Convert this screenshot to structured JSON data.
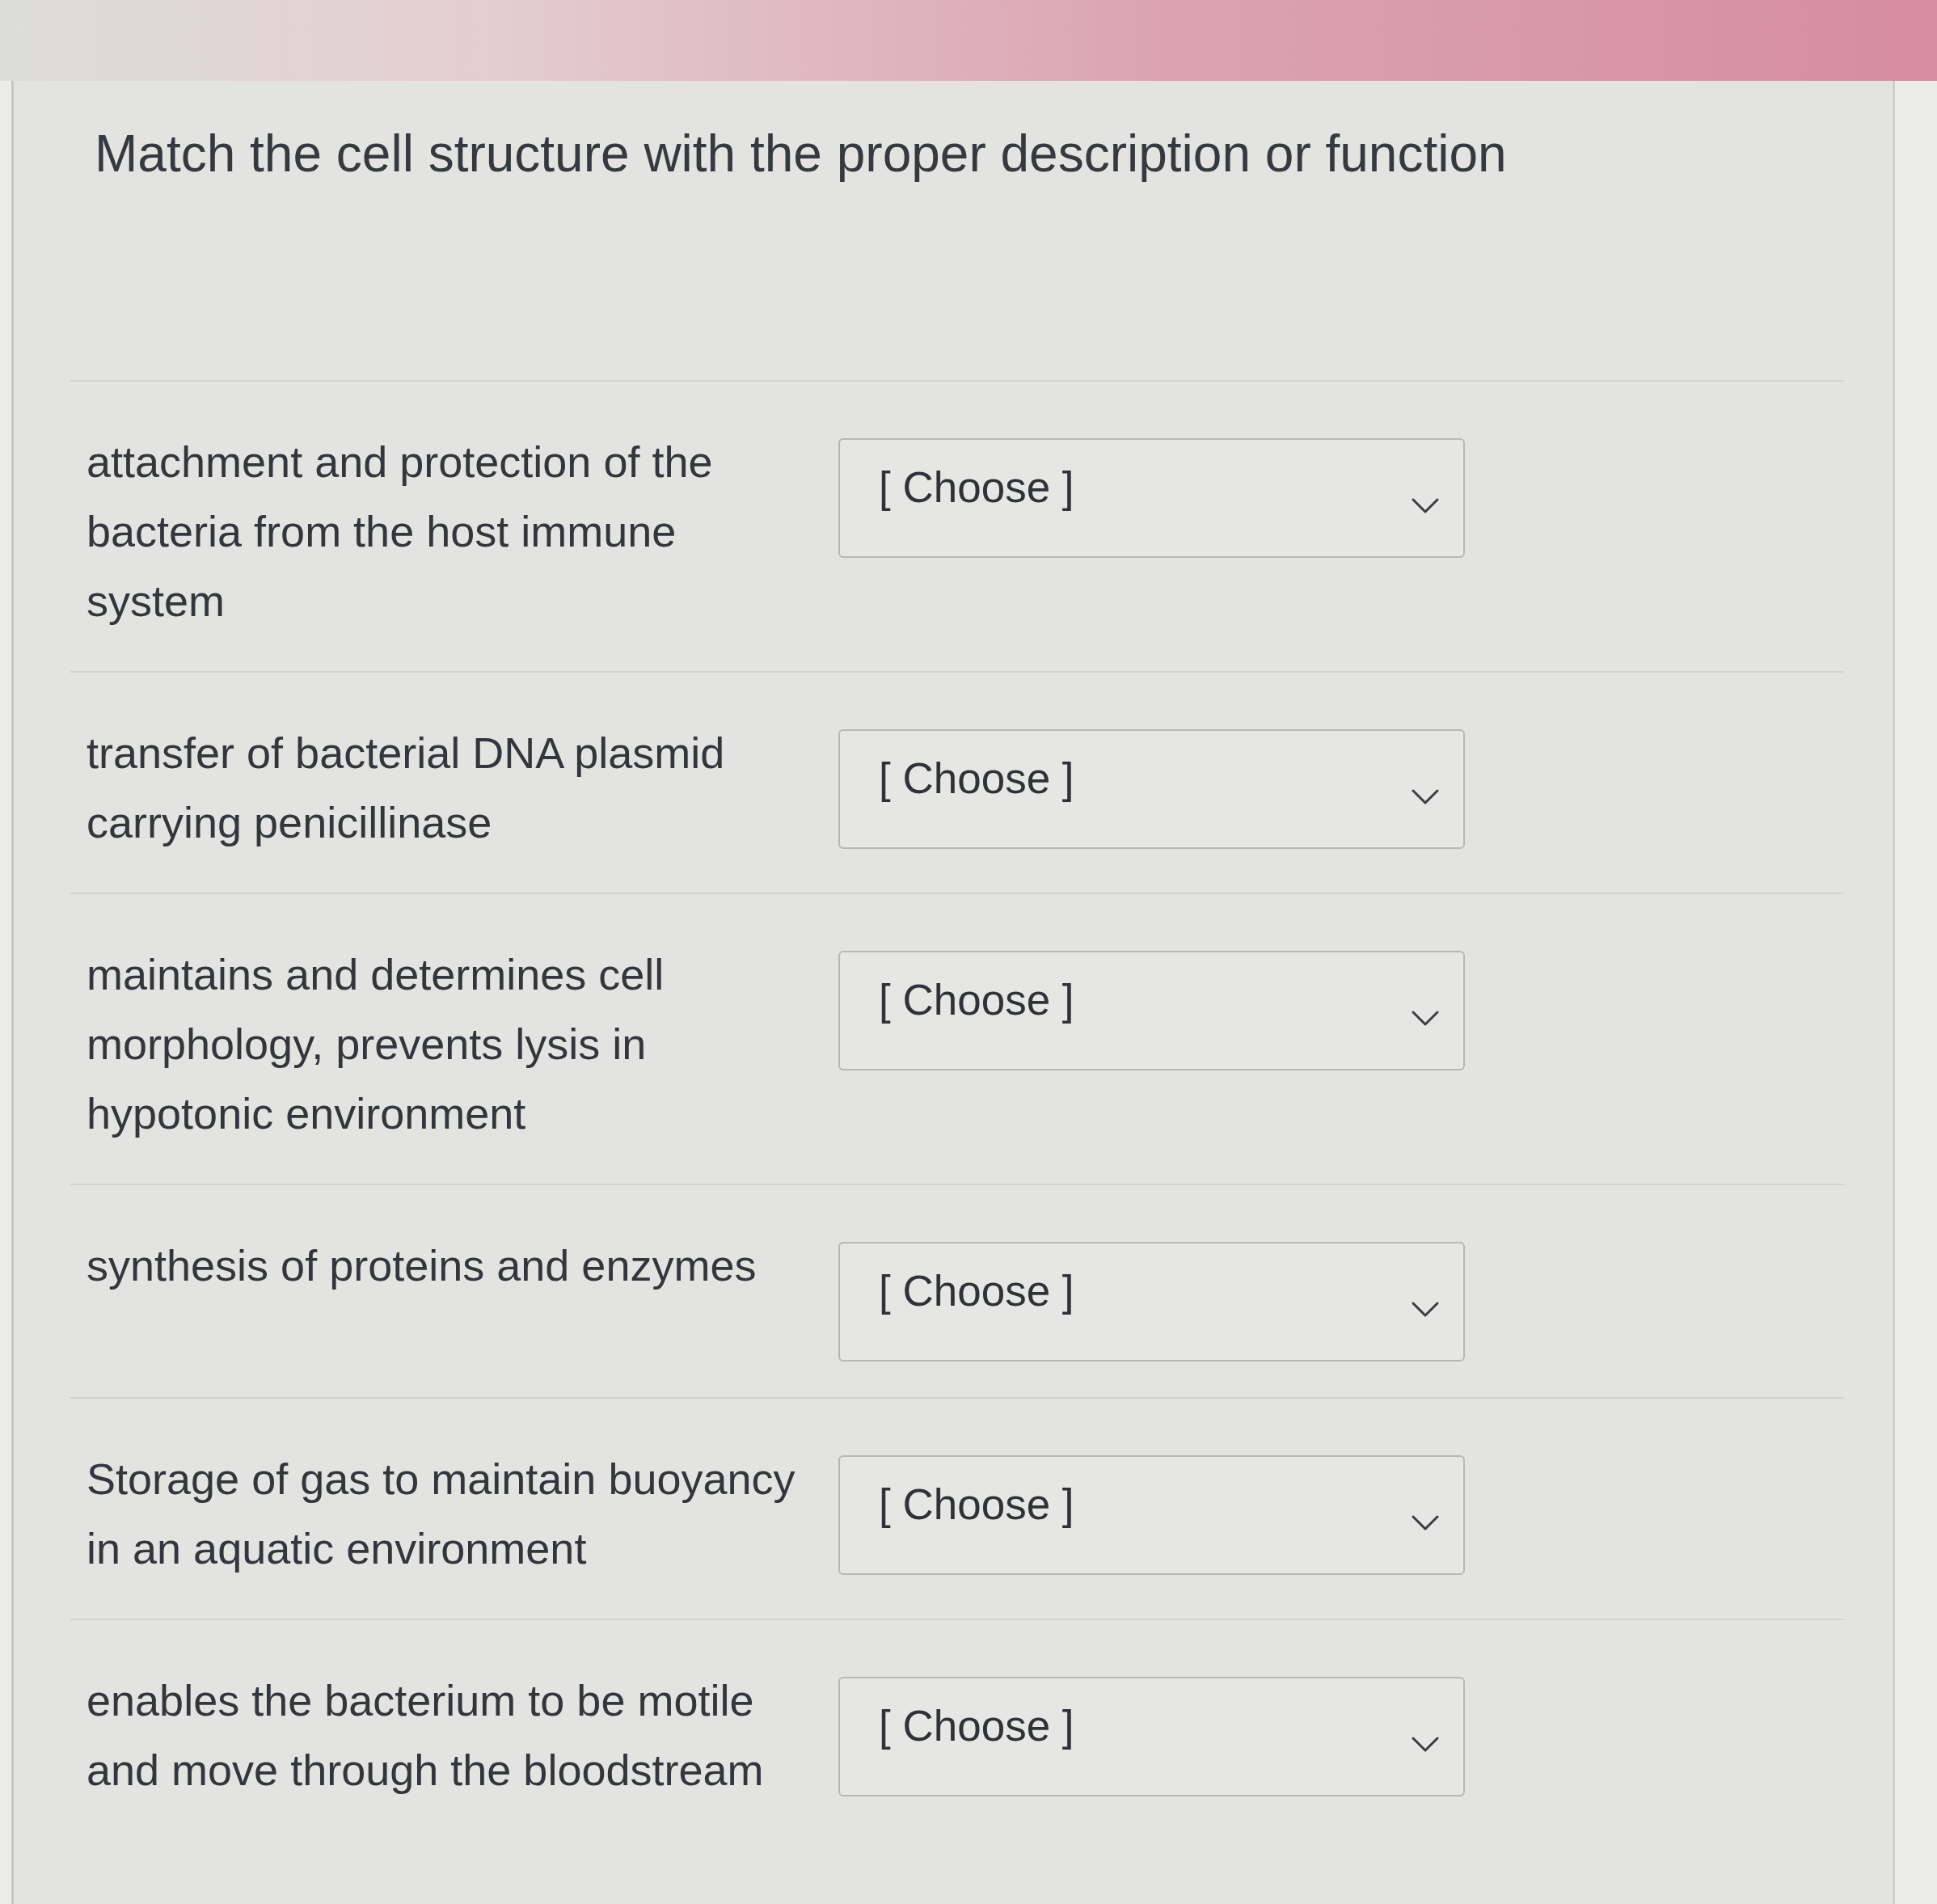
{
  "title": "Match the cell structure with the proper description or function",
  "items": [
    {
      "description": "attachment and protection of the bacteria from the host immune system",
      "dropdown": {
        "value": "[ Choose ]"
      }
    },
    {
      "description": "transfer of bacterial DNA plasmid carrying penicillinase",
      "dropdown": {
        "value": "[ Choose ]"
      }
    },
    {
      "description": "maintains and determines cell morphology, prevents lysis in hypotonic environment",
      "dropdown": {
        "value": "[ Choose ]"
      }
    },
    {
      "description": "synthesis of proteins and enzymes",
      "dropdown": {
        "value": "[ Choose ]"
      }
    },
    {
      "description": "Storage of gas to maintain buoyancy in an aquatic environment",
      "dropdown": {
        "value": "[ Choose ]"
      }
    },
    {
      "description": "enables the bacterium to be motile and move through the bloodstream",
      "dropdown": {
        "value": "[ Choose ]"
      }
    }
  ]
}
